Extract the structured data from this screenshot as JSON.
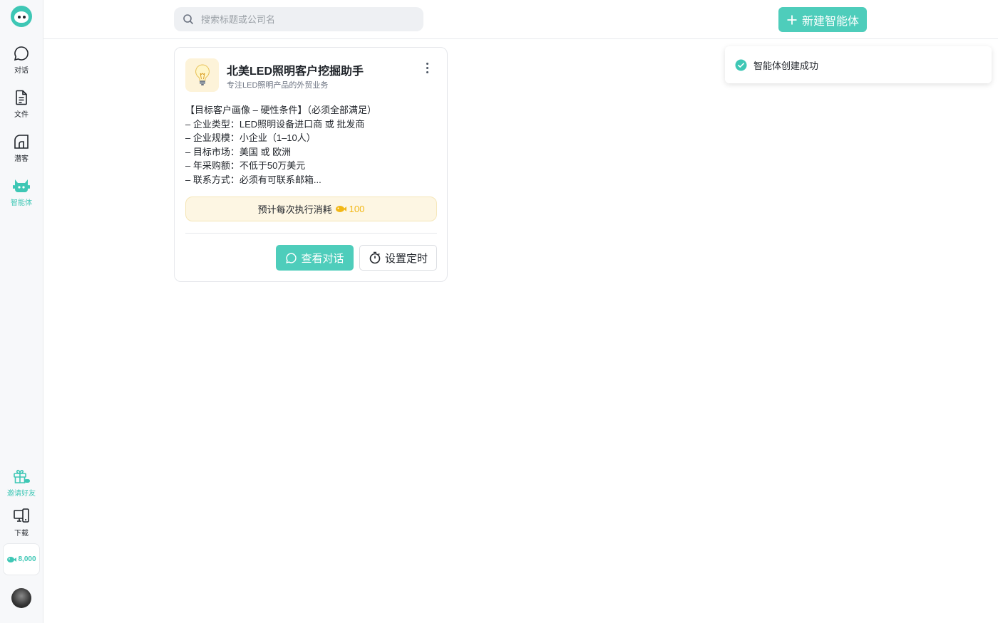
{
  "sidebar": {
    "logo_icon": "cat-logo-icon",
    "items": [
      {
        "label": "对话",
        "icon": "chat-bubble-icon"
      },
      {
        "label": "文件",
        "icon": "file-icon"
      },
      {
        "label": "潜客",
        "icon": "prospect-icon"
      },
      {
        "label": "智能体",
        "icon": "agent-cat-icon",
        "active": true
      }
    ],
    "bottom_items": [
      {
        "label": "邀请好友",
        "icon": "gift-icon"
      },
      {
        "label": "下载",
        "icon": "devices-icon"
      }
    ],
    "coins": "8,000",
    "coin_icon": "fish-coin-icon"
  },
  "header": {
    "search_placeholder": "搜索标题或公司名",
    "new_agent_label": "新建智能体"
  },
  "toast": {
    "message": "智能体创建成功",
    "icon": "check-circle-icon"
  },
  "card": {
    "icon": "light-bulb-icon",
    "title": "北美LED照明客户挖掘助手",
    "subtitle": "专注LED照明产品的外贸业务",
    "description_lines": [
      "【目标客户画像 – 硬性条件】（必须全部满足）",
      "– 企业类型：LED照明设备进口商 或 批发商",
      "– 企业规模：小企业（1–10人）",
      "– 目标市场：美国 或 欧洲",
      "– 年采购额：不低于50万美元",
      "– 联系方式：必须有可联系邮箱..."
    ],
    "cost_label": "预计每次执行消耗",
    "cost_value": "100",
    "view_chat_label": "查看对话",
    "set_timer_label": "设置定时"
  },
  "colors": {
    "accent": "#4ecdbb",
    "coin": "#f2b716",
    "toast_success": "#3ec7b5"
  }
}
